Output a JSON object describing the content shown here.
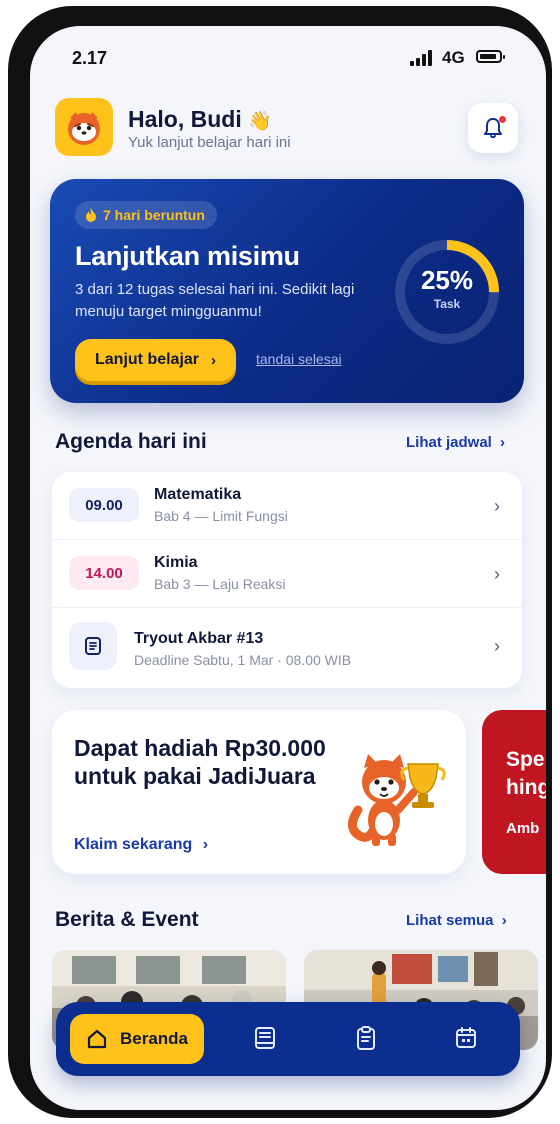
{
  "status": {
    "time": "2.17",
    "network": "4G"
  },
  "header": {
    "greeting": "Halo, Budi",
    "wave": "👋",
    "subtitle": "Yuk lanjut belajar hari ini"
  },
  "hero": {
    "streak": "7 hari beruntun",
    "title": "Lanjutkan misimu",
    "description": "3 dari 12 tugas selesai hari ini. Sedikit lagi menuju target mingguanmu!",
    "primary_button": "Lanjut belajar",
    "secondary_link": "tandai selesai",
    "progress_label": "25%",
    "progress_sublabel": "Task",
    "progress_fraction": 0.25
  },
  "agenda": {
    "title": "Agenda hari ini",
    "link": "Lihat jadwal",
    "items": [
      {
        "time": "09.00",
        "title": "Matematika",
        "subtitle": "Bab 4 — Limit Fungsi"
      },
      {
        "time": "14.00",
        "title": "Kimia",
        "subtitle": "Bab 3 — Laju Reaksi"
      },
      {
        "time": "",
        "title": "Tryout Akbar #13",
        "subtitle": "Deadline Sabtu, 1 Mar · 08.00 WIB"
      }
    ]
  },
  "promo": {
    "title": "Dapat hadiah Rp30.000 untuk pakai JadiJuara",
    "link": "Klaim sekarang"
  },
  "promo2": {
    "line1": "Spe",
    "line2": "hing",
    "line3": "Amb"
  },
  "news": {
    "title": "Berita & Event",
    "link": "Lihat semua"
  },
  "nav": {
    "home": "Beranda"
  },
  "colors": {
    "brand_blue": "#0c2e8f",
    "accent_yellow": "#ffc21a",
    "math_badge": "#eef1fb",
    "chem_badge": "#fdebf1",
    "chem_text": "#c2185b"
  }
}
